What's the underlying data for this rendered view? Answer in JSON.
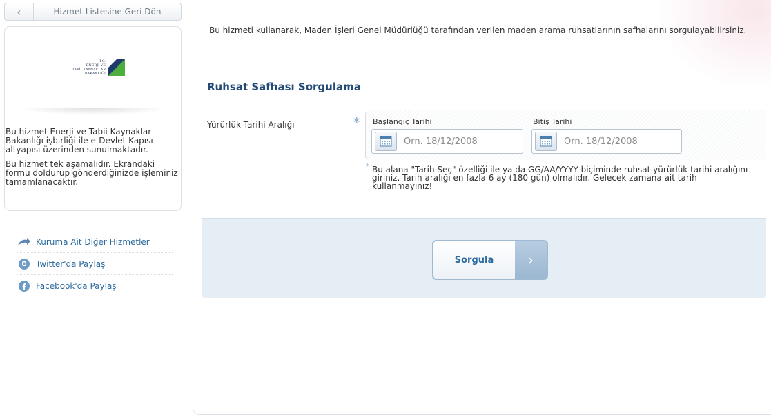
{
  "sidebar": {
    "back_label": "Hizmet Listesine Geri Dön",
    "logo": {
      "lines": [
        "T.C.",
        "ENERJİ VE",
        "TABİİ KAYNAKLAR",
        "BAKANLIĞI"
      ],
      "colors": {
        "navy": "#1f3b6b",
        "green": "#4caf3b"
      }
    },
    "info_paragraphs": [
      "Bu hizmet Enerji ve Tabii Kaynaklar Bakanlığı işbirliği ile e-Devlet Kapısı altyapısı üzerinden sunulmaktadır.",
      "Bu hizmet tek aşamalıdır. Ekrandaki formu doldurup gönderdiğinizde işleminiz tamamlanacaktır."
    ],
    "links": [
      {
        "label": "Kuruma Ait Diğer Hizmetler",
        "icon": "share-arrow-icon"
      },
      {
        "label": "Twitter'da Paylaş",
        "icon": "twitter-icon"
      },
      {
        "label": "Facebook'da Paylaş",
        "icon": "facebook-icon"
      }
    ]
  },
  "main": {
    "intro": "Bu hizmeti kullanarak, Maden İşleri Genel Müdürlüğü tarafından verilen maden arama ruhsatlarının safhalarını sorgulayabilirsiniz.",
    "section_title": "Ruhsat Safhası Sorgulama",
    "field_label": "Yürürlük Tarihi Aralığı",
    "required_mark": "*",
    "start_date": {
      "label": "Başlangıç Tarihi",
      "placeholder": "Örn. 18/12/2008",
      "value": ""
    },
    "end_date": {
      "label": "Bitiş Tarihi",
      "placeholder": "Örn. 18/12/2008",
      "value": ""
    },
    "hint_mark": "*",
    "hint": "Bu alana \"Tarih Seç\" özelliği ile ya da GG/AA/YYYY biçiminde ruhsat yürürlük tarihi aralığını giriniz. Tarih aralığı en fazla 6 ay (180 gün) olmalıdır. Gelecek zamana ait tarih kullanmayınız!",
    "submit_label": "Sorgula",
    "submit_arrow": "›"
  },
  "colors": {
    "accent": "#2e6b9e",
    "title": "#244b78",
    "band": "#e6eef5",
    "star": "#8fb3d3"
  }
}
